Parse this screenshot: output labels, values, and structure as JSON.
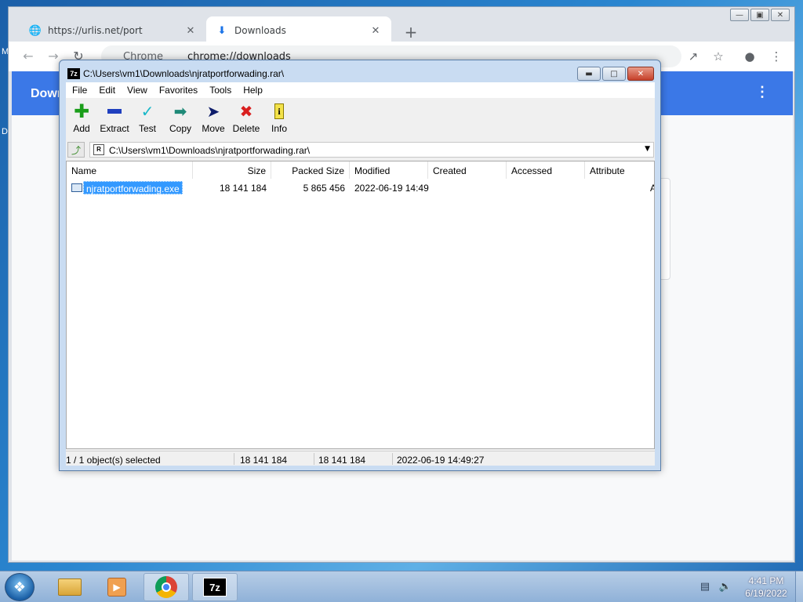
{
  "chrome": {
    "tabs": [
      {
        "title": "https://urlis.net/port",
        "favicon": "globe-icon"
      },
      {
        "title": "Downloads",
        "favicon": "download-icon"
      }
    ],
    "omnibox_site": "Chrome",
    "omnibox_url": "chrome://downloads",
    "page_header_title": "Down"
  },
  "desktop_letters": [
    "M",
    "D"
  ],
  "zip": {
    "title": "C:\\Users\\vm1\\Downloads\\njratportforwading.rar\\",
    "app_icon_text": "7z",
    "menu": [
      "File",
      "Edit",
      "View",
      "Favorites",
      "Tools",
      "Help"
    ],
    "toolbar": [
      {
        "label": "Add",
        "icon": "plus-icon",
        "color": "#1a9e1a"
      },
      {
        "label": "Extract",
        "icon": "minus-icon",
        "color": "#1f3fbf"
      },
      {
        "label": "Test",
        "icon": "check-icon",
        "color": "#18b8c8"
      },
      {
        "label": "Copy",
        "icon": "copy-arrow-icon",
        "color": "#1f8a78"
      },
      {
        "label": "Move",
        "icon": "move-arrow-icon",
        "color": "#0e1d6b"
      },
      {
        "label": "Delete",
        "icon": "delete-x-icon",
        "color": "#d91f1f"
      },
      {
        "label": "Info",
        "icon": "info-icon",
        "color": "#e6c400"
      }
    ],
    "address": "C:\\Users\\vm1\\Downloads\\njratportforwading.rar\\",
    "address_icon_text": "R",
    "columns": [
      "Name",
      "Size",
      "Packed Size",
      "Modified",
      "Created",
      "Accessed",
      "Attribute"
    ],
    "rows": [
      {
        "name": "njratportforwading.exe",
        "size": "18 141 184",
        "packed": "5 865 456",
        "modified": "2022-06-19 14:49",
        "created": "",
        "accessed": "",
        "attr": "A"
      }
    ],
    "status": {
      "selected": "1 / 1 object(s) selected",
      "size": "18 141 184",
      "packed": "18 141 184",
      "modified": "2022-06-19 14:49:27"
    }
  },
  "taskbar": {
    "apps": [
      "folder-icon",
      "media-player-icon",
      "chrome-icon",
      "7zip-icon"
    ],
    "zip_icon_text": "7z",
    "time": "4:41 PM",
    "date": "6/19/2022"
  }
}
